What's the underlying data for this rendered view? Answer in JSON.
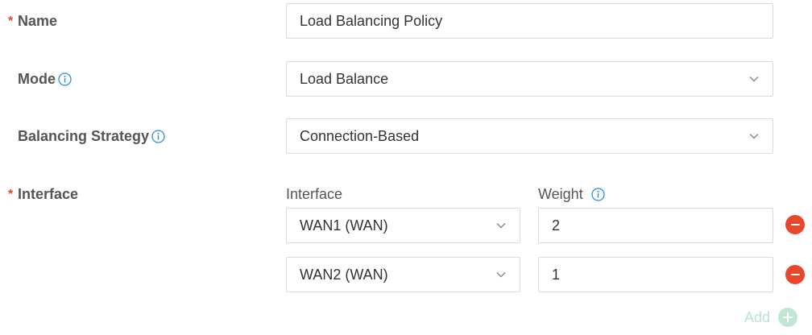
{
  "form": {
    "name": {
      "label": "Name",
      "required_mark": "*",
      "value": "Load Balancing Policy"
    },
    "mode": {
      "label": "Mode",
      "value": "Load Balance"
    },
    "strategy": {
      "label": "Balancing Strategy",
      "value": "Connection-Based"
    },
    "interface": {
      "label": "Interface",
      "required_mark": "*",
      "column_interface": "Interface",
      "column_weight": "Weight",
      "rows": [
        {
          "interface": "WAN1 (WAN)",
          "weight": "2"
        },
        {
          "interface": "WAN2 (WAN)",
          "weight": "1"
        }
      ],
      "add_label": "Add"
    }
  },
  "colors": {
    "required": "#e8472b",
    "info_icon": "#2b8de0",
    "remove": "#e8472b",
    "add_disabled": "#bfe7d4"
  },
  "icons": {
    "info": "info-icon",
    "dropdown": "chevron-down-icon",
    "remove": "minus-circle-icon",
    "add": "plus-circle-icon"
  }
}
